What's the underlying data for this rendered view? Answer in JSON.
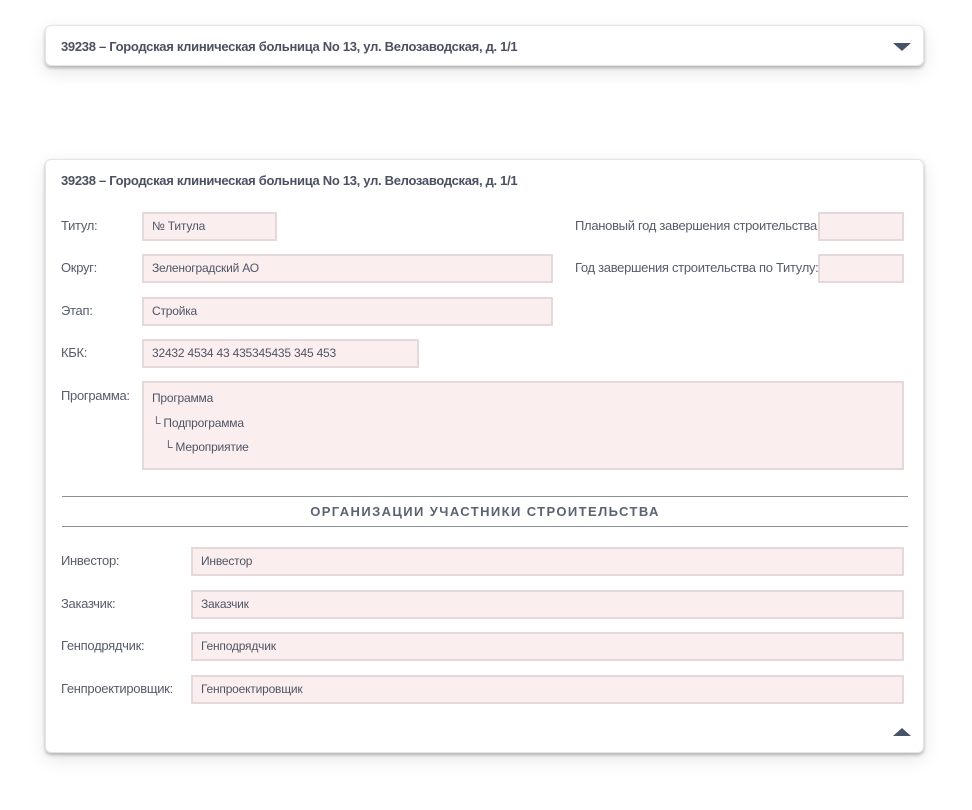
{
  "collapsed_card": {
    "header": "39238 – Городская клиническая больница No 13, ул. Велозаводская, д. 1/1"
  },
  "expanded_card": {
    "header": "39238 – Городская клиническая больница No 13, ул. Велозаводская, д. 1/1",
    "fields": {
      "titul": {
        "label": "Титул:",
        "value": "№ Титула"
      },
      "okrug": {
        "label": "Округ:",
        "value": "Зеленоградский АО"
      },
      "etap": {
        "label": "Этап:",
        "value": "Стройка"
      },
      "kbk": {
        "label": "КБК:",
        "value": "32432 4534 43 435345435 345 453"
      },
      "programma": {
        "label": "Программа:",
        "line1": "Программа",
        "line2": "└ Подпрограмма",
        "line3": "└ Мероприятие"
      },
      "planned_year": {
        "label": "Плановый год завершения строительства:",
        "value": ""
      },
      "titul_year": {
        "label": "Год завершения строительства по Титулу:",
        "value": ""
      }
    },
    "section_title": "ОРГАНИЗАЦИИ УЧАСТНИКИ СТРОИТЕЛЬСТВА",
    "participants": {
      "investor": {
        "label": "Инвестор:",
        "value": "Инвестор"
      },
      "zakazchik": {
        "label": "Заказчик:",
        "value": "Заказчик"
      },
      "genpodryadchik": {
        "label": "Генподрядчик:",
        "value": "Генподрядчик"
      },
      "genproektirovshchik": {
        "label": "Генпроектировщик:",
        "value": "Генпроектировщик"
      }
    }
  },
  "icons": {
    "expand": "triangle-down-icon",
    "collapse": "triangle-up-icon"
  },
  "colors": {
    "field_bg": "#faeeee",
    "field_border": "#e4d8d8",
    "text": "#4b5161",
    "icon": "#48536a"
  }
}
